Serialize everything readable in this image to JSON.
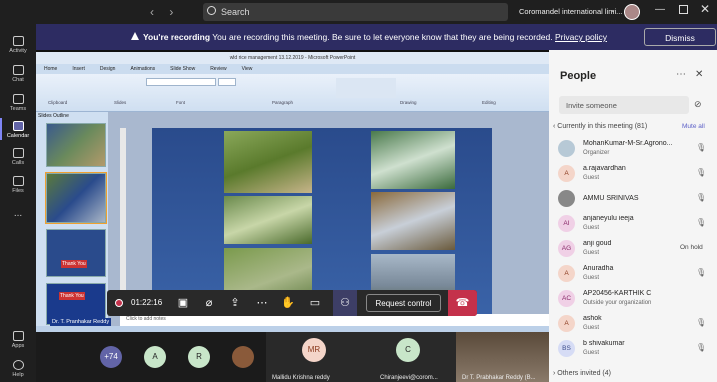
{
  "titlebar": {
    "search_placeholder": "Search",
    "org": "Coromandel international limi...",
    "icons": [
      "back-arrow-icon",
      "forward-arrow-icon",
      "search-icon",
      "chevron-down-icon",
      "minimize-icon",
      "maximize-icon",
      "close-icon"
    ]
  },
  "rail": {
    "items": [
      {
        "label": "Activity"
      },
      {
        "label": "Chat"
      },
      {
        "label": "Teams"
      },
      {
        "label": "Calendar",
        "active": true
      },
      {
        "label": "Calls"
      },
      {
        "label": "Files"
      },
      {
        "label": "..."
      },
      {
        "label": "Apps"
      },
      {
        "label": "Help"
      }
    ],
    "accent": "#7f85f5"
  },
  "banner": {
    "bold": "You're recording",
    "text": "You are recording this meeting. Be sure to let everyone know that they are being recorded.",
    "link": "Privacy policy",
    "dismiss": "Dismiss",
    "color": "#2d2c62"
  },
  "powerpoint": {
    "title": "wld rice management 13.12.2019 - Microsoft PowerPoint",
    "tabs": [
      "Home",
      "Insert",
      "Design",
      "Animations",
      "Slide Show",
      "Review",
      "View"
    ],
    "groups": [
      "Clipboard",
      "Slides",
      "Font",
      "Paragraph",
      "Drawing",
      "Editing"
    ],
    "left_tabs": "Slides   Outline",
    "thumb_labels": {
      "t3": "Thank You",
      "t4": "Thank You",
      "presenter": "Dr. T. Pranhakar Reddy"
    },
    "notes": "Click to add notes"
  },
  "toolbar": {
    "timer": "01:22:16",
    "request_control": "Request control",
    "leave_color": "#c4314b"
  },
  "strip": {
    "overflow": "+74",
    "avatars": [
      {
        "initials": "A"
      },
      {
        "initials": "R"
      },
      {
        "initials": "MR"
      },
      {
        "initials": "C"
      }
    ],
    "tiles": [
      {
        "name": "Mallidu Krishna reddy"
      },
      {
        "name": "Chiranjeevi@corom..."
      },
      {
        "name": "Dr T. Prabhakar Reddy (B..."
      }
    ]
  },
  "people": {
    "title": "People",
    "invite_placeholder": "Invite someone",
    "section": "Currently in this meeting (81)",
    "mute_all": "Mute all",
    "others": "Others invited (4)",
    "list": [
      {
        "initials": "",
        "name": "MohanKumar-M-Sr.Agrono...",
        "role": "Organizer"
      },
      {
        "initials": "A",
        "name": "a.rajavardhan",
        "role": "Guest"
      },
      {
        "initials": "",
        "name": "AMMU SRINIVAS",
        "role": ""
      },
      {
        "initials": "AI",
        "name": "anjaneyulu ieeja",
        "role": "Guest"
      },
      {
        "initials": "AG",
        "name": "anji goud",
        "role": "Guest",
        "status": "On hold"
      },
      {
        "initials": "A",
        "name": "Anuradha",
        "role": "Guest"
      },
      {
        "initials": "AC",
        "name": "AP20456-KARTHIK C",
        "role": "Outside your organization"
      },
      {
        "initials": "A",
        "name": "ashok",
        "role": "Guest"
      },
      {
        "initials": "BS",
        "name": "b shivakumar",
        "role": "Guest"
      }
    ]
  }
}
